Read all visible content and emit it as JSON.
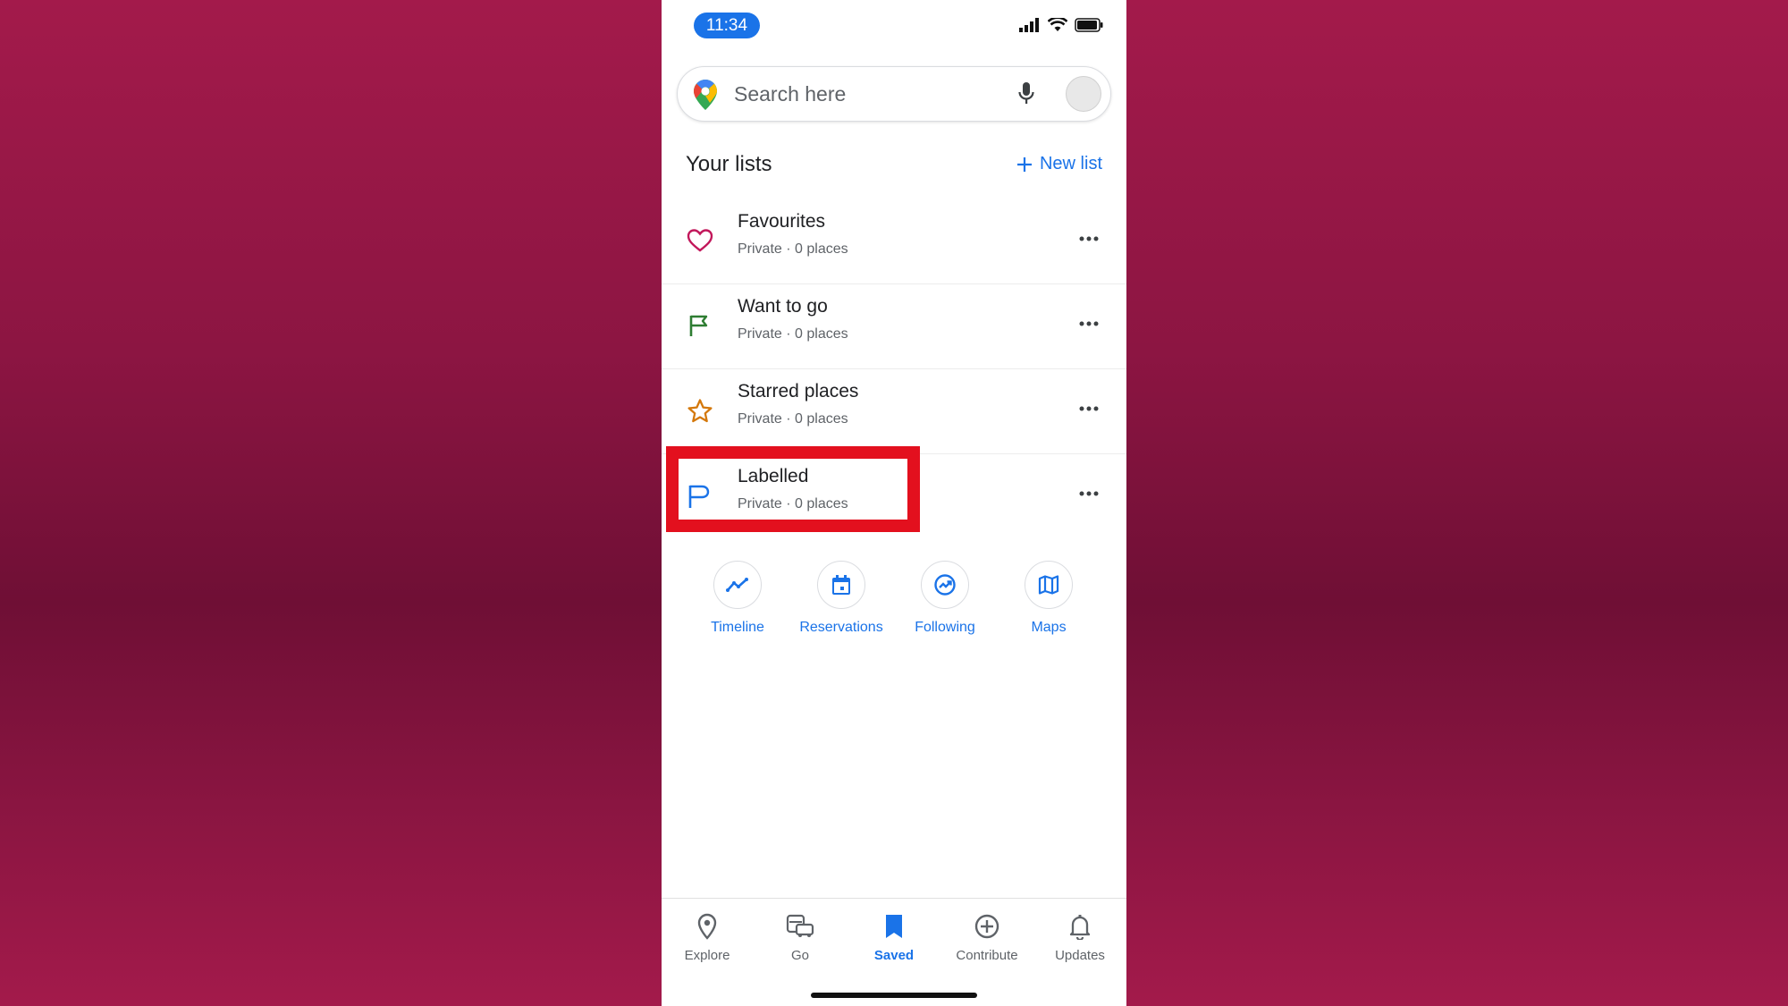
{
  "status_bar": {
    "time": "11:34"
  },
  "search": {
    "placeholder": "Search here"
  },
  "lists_header": {
    "title": "Your lists",
    "new_list_label": "New list"
  },
  "lists": [
    {
      "name": "Favourites",
      "meta": "Private · 0 places",
      "icon": "heart-icon",
      "color": "#c2185b"
    },
    {
      "name": "Want to go",
      "meta": "Private · 0 places",
      "icon": "flag-icon",
      "color": "#2e7d32"
    },
    {
      "name": "Starred places",
      "meta": "Private · 0 places",
      "icon": "star-icon",
      "color": "#d4780b"
    },
    {
      "name": "Labelled",
      "meta": "Private · 0 places",
      "icon": "label-flag-icon",
      "color": "#1a73e8"
    }
  ],
  "shortcuts": [
    {
      "label": "Timeline",
      "icon": "timeline-icon"
    },
    {
      "label": "Reservations",
      "icon": "calendar-icon"
    },
    {
      "label": "Following",
      "icon": "following-icon"
    },
    {
      "label": "Maps",
      "icon": "map-icon"
    }
  ],
  "bottom_nav": [
    {
      "label": "Explore",
      "icon": "location-pin-icon",
      "active": false
    },
    {
      "label": "Go",
      "icon": "commute-icon",
      "active": false
    },
    {
      "label": "Saved",
      "icon": "bookmark-icon",
      "active": true
    },
    {
      "label": "Contribute",
      "icon": "add-circle-icon",
      "active": false
    },
    {
      "label": "Updates",
      "icon": "bell-icon",
      "active": false
    }
  ],
  "colors": {
    "accent": "#1a73e8",
    "highlight": "#e3101e",
    "background": "#8c1542"
  }
}
